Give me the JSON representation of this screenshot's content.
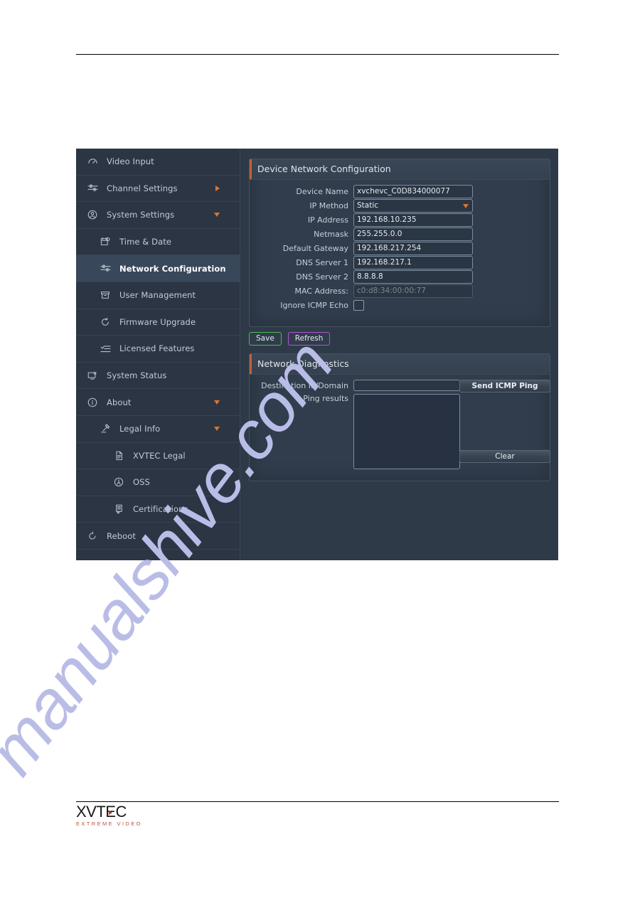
{
  "watermark": {
    "text": "manualshive.com"
  },
  "footer": {
    "brand": "XVTEC",
    "tagline": "EXTREME VIDEO"
  },
  "app": {
    "sidebar": {
      "items": [
        {
          "label": "Video Input",
          "icon": "gauge-icon",
          "level": 0,
          "active": false,
          "caret": "none"
        },
        {
          "label": "Channel Settings",
          "icon": "sliders-icon",
          "level": 0,
          "active": false,
          "caret": "right"
        },
        {
          "label": "System Settings",
          "icon": "user-circle-icon",
          "level": 0,
          "active": false,
          "caret": "down"
        },
        {
          "label": "Time & Date",
          "icon": "calendar-clock-icon",
          "level": 1,
          "active": false,
          "caret": "none"
        },
        {
          "label": "Network Configuration",
          "icon": "sliders-icon",
          "level": 1,
          "active": true,
          "caret": "none"
        },
        {
          "label": "User Management",
          "icon": "archive-box-icon",
          "level": 1,
          "active": false,
          "caret": "none"
        },
        {
          "label": "Firmware Upgrade",
          "icon": "refresh-icon",
          "level": 1,
          "active": false,
          "caret": "none"
        },
        {
          "label": "Licensed Features",
          "icon": "checklist-icon",
          "level": 1,
          "active": false,
          "caret": "none"
        },
        {
          "label": "System Status",
          "icon": "monitor-check-icon",
          "level": 0,
          "active": false,
          "caret": "none"
        },
        {
          "label": "About",
          "icon": "info-circle-icon",
          "level": 0,
          "active": false,
          "caret": "down"
        },
        {
          "label": "Legal Info",
          "icon": "gavel-icon",
          "level": 1,
          "active": false,
          "caret": "down"
        },
        {
          "label": "XVTEC Legal",
          "icon": "document-icon",
          "level": 2,
          "active": false,
          "caret": "none"
        },
        {
          "label": "OSS",
          "icon": "opensource-icon",
          "level": 2,
          "active": false,
          "caret": "none"
        },
        {
          "label": "Certifications",
          "icon": "certificate-icon",
          "level": 2,
          "active": false,
          "caret": "none"
        },
        {
          "label": "Reboot",
          "icon": "power-cycle-icon",
          "level": 0,
          "active": false,
          "caret": "none"
        }
      ]
    },
    "device_panel": {
      "title": "Device Network Configuration",
      "fields": [
        {
          "label": "Device Name",
          "value": "xvchevc_C0D834000077",
          "type": "text"
        },
        {
          "label": "IP Method",
          "value": "Static",
          "type": "select"
        },
        {
          "label": "IP Address",
          "value": "192.168.10.235",
          "type": "text"
        },
        {
          "label": "Netmask",
          "value": "255.255.0.0",
          "type": "text"
        },
        {
          "label": "Default Gateway",
          "value": "192.168.217.254",
          "type": "text"
        },
        {
          "label": "DNS Server 1",
          "value": "192.168.217.1",
          "type": "text"
        },
        {
          "label": "DNS Server 2",
          "value": "8.8.8.8",
          "type": "text"
        },
        {
          "label": "MAC Address:",
          "value": "c0:d8:34:00:00:77",
          "type": "readonly"
        },
        {
          "label": "Ignore ICMP Echo",
          "value": "",
          "type": "checkbox"
        }
      ]
    },
    "actions": {
      "save": "Save",
      "refresh": "Refresh"
    },
    "diagnostics": {
      "title": "Network Diagnostics",
      "destination_label": "Destination IP/Domain",
      "destination_value": "",
      "results_label": "Ping results",
      "results_value": "",
      "send_button": "Send ICMP Ping",
      "clear_button": "Clear"
    },
    "colors": {
      "accent_orange": "#e2742a",
      "save_green": "#49bf4c",
      "refresh_purple": "#b153d6",
      "panel_bg": "#313d4d",
      "sidebar_bg": "#2b3544"
    }
  }
}
